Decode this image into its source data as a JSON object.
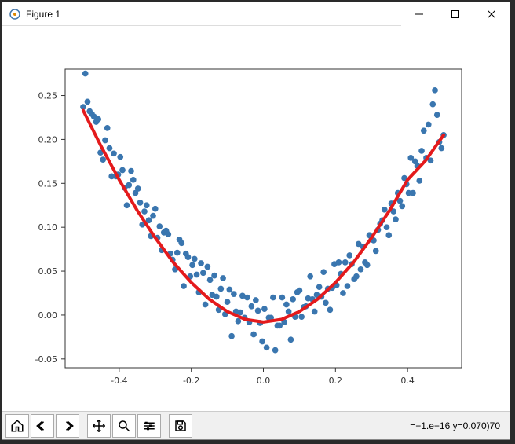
{
  "window": {
    "title": "Figure 1"
  },
  "toolbar": {
    "status": "=−1.e−16 y=0.070)70"
  },
  "chart_data": {
    "type": "scatter+line",
    "xlabel": "",
    "ylabel": "",
    "title": "",
    "xlim": [
      -0.55,
      0.55
    ],
    "ylim": [
      -0.06,
      0.28
    ],
    "xticks": [
      -0.4,
      -0.2,
      0.0,
      0.2,
      0.4
    ],
    "yticks": [
      -0.05,
      0.0,
      0.05,
      0.1,
      0.15,
      0.2,
      0.25
    ],
    "series": [
      {
        "name": "scatter",
        "type": "scatter",
        "color": "#3a76af",
        "x": [
          -0.5,
          -0.494,
          -0.488,
          -0.482,
          -0.476,
          -0.47,
          -0.464,
          -0.458,
          -0.452,
          -0.445,
          -0.439,
          -0.433,
          -0.427,
          -0.421,
          -0.415,
          -0.409,
          -0.403,
          -0.397,
          -0.391,
          -0.385,
          -0.379,
          -0.373,
          -0.367,
          -0.361,
          -0.355,
          -0.348,
          -0.342,
          -0.336,
          -0.33,
          -0.324,
          -0.318,
          -0.312,
          -0.306,
          -0.3,
          -0.294,
          -0.288,
          -0.282,
          -0.276,
          -0.27,
          -0.264,
          -0.258,
          -0.252,
          -0.245,
          -0.239,
          -0.233,
          -0.227,
          -0.221,
          -0.215,
          -0.209,
          -0.203,
          -0.197,
          -0.191,
          -0.185,
          -0.179,
          -0.173,
          -0.167,
          -0.161,
          -0.155,
          -0.148,
          -0.142,
          -0.136,
          -0.13,
          -0.124,
          -0.118,
          -0.112,
          -0.106,
          -0.1,
          -0.094,
          -0.088,
          -0.082,
          -0.076,
          -0.07,
          -0.064,
          -0.058,
          -0.052,
          -0.045,
          -0.039,
          -0.033,
          -0.027,
          -0.021,
          -0.015,
          -0.009,
          -0.003,
          0.003,
          0.009,
          0.015,
          0.021,
          0.027,
          0.033,
          0.039,
          0.045,
          0.052,
          0.058,
          0.064,
          0.07,
          0.076,
          0.082,
          0.088,
          0.094,
          0.1,
          0.106,
          0.112,
          0.118,
          0.124,
          0.13,
          0.136,
          0.142,
          0.148,
          0.155,
          0.161,
          0.167,
          0.173,
          0.179,
          0.185,
          0.191,
          0.197,
          0.203,
          0.209,
          0.215,
          0.221,
          0.227,
          0.233,
          0.239,
          0.245,
          0.252,
          0.258,
          0.264,
          0.27,
          0.276,
          0.282,
          0.288,
          0.294,
          0.3,
          0.306,
          0.312,
          0.318,
          0.324,
          0.33,
          0.336,
          0.342,
          0.348,
          0.355,
          0.361,
          0.367,
          0.373,
          0.379,
          0.385,
          0.391,
          0.397,
          0.403,
          0.409,
          0.415,
          0.421,
          0.427,
          0.433,
          0.439,
          0.445,
          0.452,
          0.458,
          0.464,
          0.47,
          0.476,
          0.482,
          0.488,
          0.494,
          0.5
        ],
        "y": [
          0.237,
          0.275,
          0.243,
          0.232,
          0.229,
          0.226,
          0.22,
          0.223,
          0.185,
          0.177,
          0.199,
          0.213,
          0.19,
          0.158,
          0.184,
          0.158,
          0.16,
          0.18,
          0.165,
          0.145,
          0.125,
          0.148,
          0.164,
          0.154,
          0.139,
          0.144,
          0.128,
          0.103,
          0.118,
          0.125,
          0.108,
          0.09,
          0.113,
          0.121,
          0.088,
          0.101,
          0.074,
          0.094,
          0.096,
          0.092,
          0.07,
          0.063,
          0.052,
          0.071,
          0.086,
          0.082,
          0.033,
          0.07,
          0.066,
          0.044,
          0.057,
          0.064,
          0.046,
          0.026,
          0.059,
          0.048,
          0.012,
          0.055,
          0.04,
          0.023,
          0.045,
          0.021,
          0.006,
          0.03,
          0.042,
          0.001,
          0.015,
          0.029,
          -0.024,
          0.024,
          0.004,
          -0.007,
          0.003,
          0.022,
          -0.003,
          0.02,
          -0.008,
          0.01,
          -0.022,
          0.017,
          0.005,
          -0.009,
          -0.03,
          0.007,
          -0.037,
          -0.003,
          -0.003,
          0.02,
          -0.04,
          -0.012,
          -0.012,
          0.02,
          -0.008,
          0.012,
          0.004,
          -0.028,
          0.018,
          -0.002,
          0.026,
          0.028,
          -0.002,
          0.009,
          0.01,
          0.019,
          0.044,
          0.018,
          0.004,
          0.023,
          0.032,
          0.021,
          0.049,
          0.014,
          0.03,
          0.006,
          0.031,
          0.058,
          0.034,
          0.06,
          0.047,
          0.025,
          0.06,
          0.033,
          0.068,
          0.058,
          0.041,
          0.044,
          0.081,
          0.052,
          0.078,
          0.06,
          0.057,
          0.091,
          0.086,
          0.085,
          0.073,
          0.097,
          0.104,
          0.108,
          0.12,
          0.1,
          0.091,
          0.127,
          0.118,
          0.109,
          0.139,
          0.13,
          0.124,
          0.156,
          0.149,
          0.139,
          0.179,
          0.139,
          0.175,
          0.17,
          0.153,
          0.187,
          0.21,
          0.179,
          0.217,
          0.176,
          0.24,
          0.256,
          0.228,
          0.197,
          0.19,
          0.205
        ],
        "marker_size": 5
      },
      {
        "name": "fit",
        "type": "line",
        "color": "#e41a1c",
        "linewidth": 4,
        "x": [
          -0.5,
          -0.45,
          -0.4,
          -0.35,
          -0.3,
          -0.25,
          -0.2,
          -0.15,
          -0.1,
          -0.05,
          0.0,
          0.05,
          0.1,
          0.15,
          0.2,
          0.25,
          0.3,
          0.35,
          0.4,
          0.45,
          0.5
        ],
        "y": [
          0.233,
          0.192,
          0.154,
          0.119,
          0.088,
          0.06,
          0.037,
          0.018,
          0.004,
          -0.005,
          -0.008,
          -0.005,
          0.004,
          0.018,
          0.037,
          0.06,
          0.088,
          0.119,
          0.154,
          0.176,
          0.205
        ]
      }
    ]
  }
}
